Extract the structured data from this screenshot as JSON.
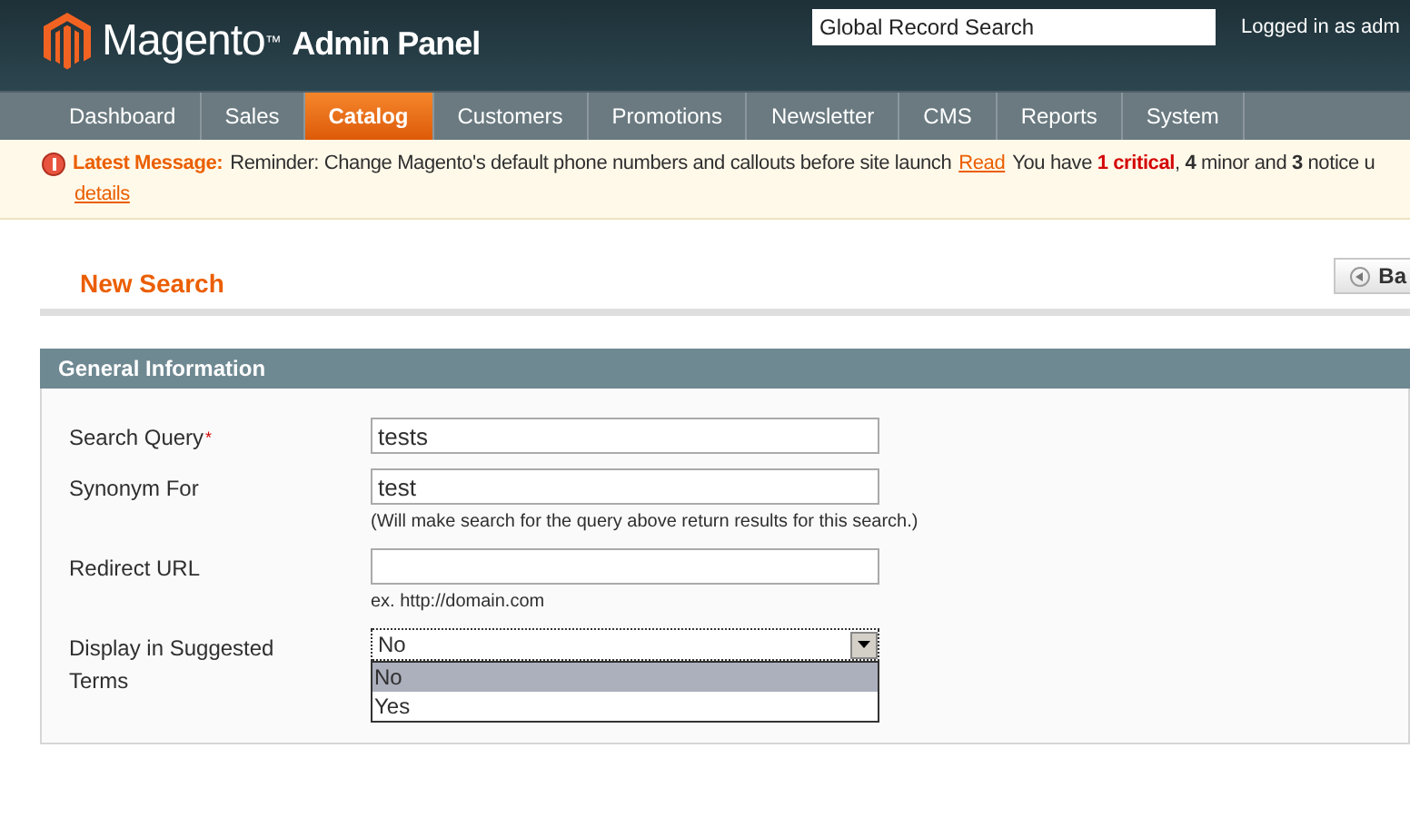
{
  "header": {
    "logo": {
      "brand": "Magento",
      "tm": "™",
      "product": "Admin Panel"
    },
    "search": {
      "placeholder": "Global Record Search"
    },
    "user": "Logged in as adm"
  },
  "nav": [
    {
      "label": "Dashboard",
      "selected": false
    },
    {
      "label": "Sales",
      "selected": false
    },
    {
      "label": "Catalog",
      "selected": true
    },
    {
      "label": "Customers",
      "selected": false
    },
    {
      "label": "Promotions",
      "selected": false
    },
    {
      "label": "Newsletter",
      "selected": false
    },
    {
      "label": "CMS",
      "selected": false
    },
    {
      "label": "Reports",
      "selected": false
    },
    {
      "label": "System",
      "selected": false
    }
  ],
  "message": {
    "label": "Latest Message:",
    "text": "Reminder: Change Magento's default phone numbers and callouts before site launch",
    "read_link": "Read",
    "prefix": "You have",
    "critical": "1 critical",
    "rest": ", **4** minor and **3** notice u",
    "details_link": "details"
  },
  "page": {
    "title": "New Search",
    "back_button": "Ba"
  },
  "section": {
    "title": "General Information",
    "fields": [
      {
        "kind": "text",
        "label": "Search Query",
        "required_mark": "*",
        "value": "tests"
      },
      {
        "kind": "text",
        "label": "Synonym For",
        "value": "test",
        "note": "(Will make search for the query above return results for this search.)"
      },
      {
        "kind": "text",
        "label": "Redirect URL",
        "note": "ex. http://domain.com"
      },
      {
        "kind": "select",
        "label": "Display in Suggested Terms",
        "value": "No",
        "expanded": true,
        "options": [
          {
            "label": "No",
            "selected": true
          },
          {
            "label": "Yes",
            "selected": false
          }
        ]
      }
    ]
  }
}
